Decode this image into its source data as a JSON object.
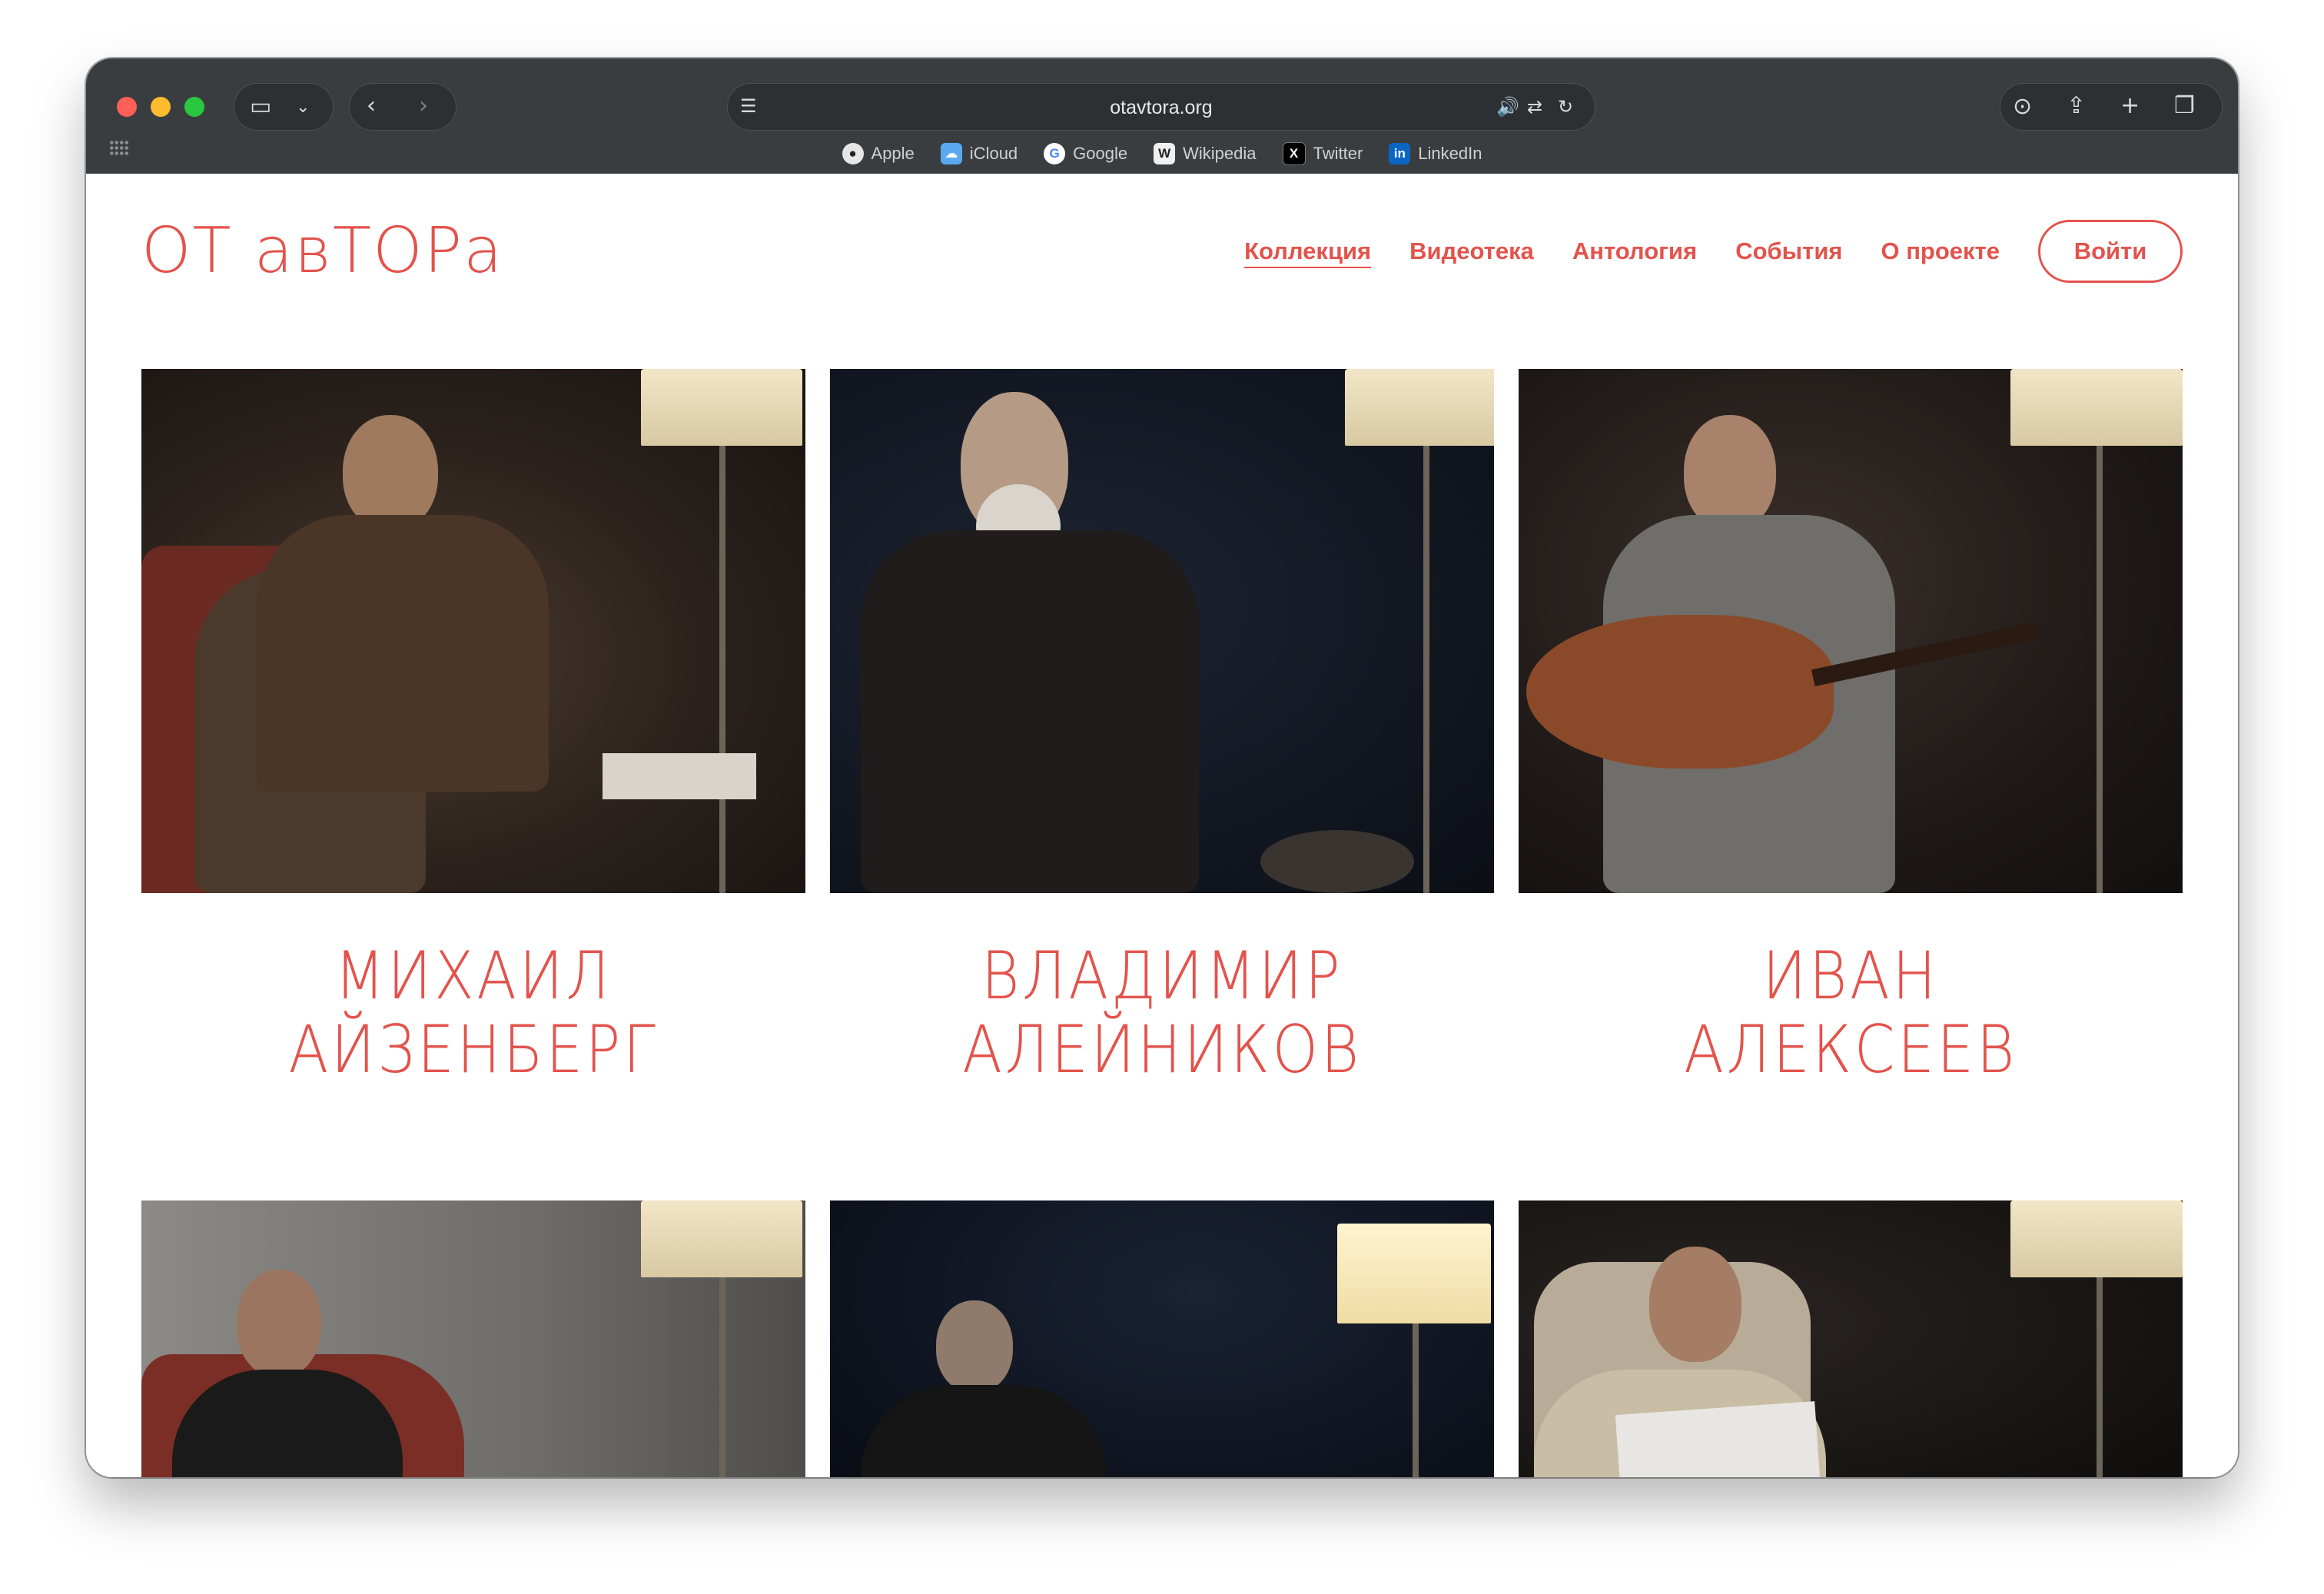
{
  "browser": {
    "url": "otavtora.org",
    "favorites": [
      {
        "label": "Apple",
        "icon": "apple-icon"
      },
      {
        "label": "iCloud",
        "icon": "icloud-icon"
      },
      {
        "label": "Google",
        "icon": "google-icon"
      },
      {
        "label": "Wikipedia",
        "icon": "wikipedia-icon"
      },
      {
        "label": "Twitter",
        "icon": "x-icon"
      },
      {
        "label": "LinkedIn",
        "icon": "linkedin-icon"
      }
    ]
  },
  "site": {
    "logo": "ОТ авТОРа",
    "accent_color": "#e3534c",
    "nav": [
      {
        "label": "Коллекция",
        "active": true
      },
      {
        "label": "Видеотека",
        "active": false
      },
      {
        "label": "Антология",
        "active": false
      },
      {
        "label": "События",
        "active": false
      },
      {
        "label": "О проекте",
        "active": false
      }
    ],
    "login_label": "Войти"
  },
  "authors": [
    {
      "line1": "МИХАИЛ",
      "line2": "АЙЗЕНБЕРГ"
    },
    {
      "line1": "ВЛАДИМИР",
      "line2": "АЛЕЙНИКОВ"
    },
    {
      "line1": "ИВАН",
      "line2": "АЛЕКСЕЕВ"
    },
    {
      "line1": "",
      "line2": ""
    },
    {
      "line1": "",
      "line2": ""
    },
    {
      "line1": "",
      "line2": ""
    }
  ]
}
